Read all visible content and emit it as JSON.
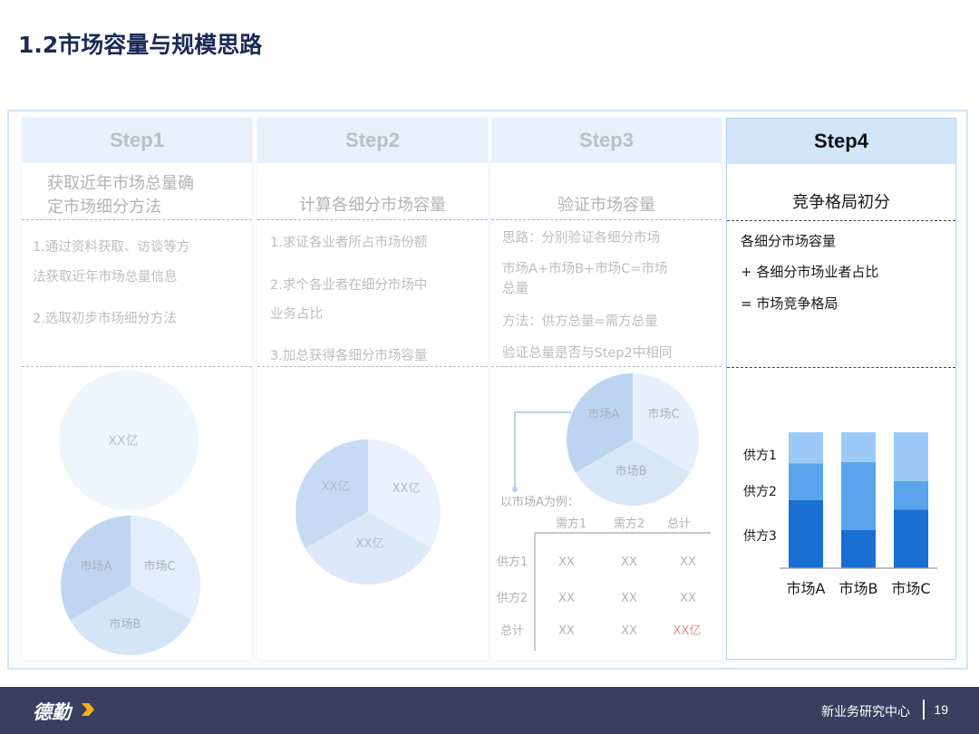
{
  "title": "1.2市场容量与规模思路",
  "steps": [
    {
      "label": "Step1",
      "heading": [
        "获取近年市场总量确",
        "定市场细分方法"
      ],
      "lines": [
        "1.通过资料获取、访谈等方",
        "法获取近年市场总量信息",
        "2.选取初步市场细分方法"
      ],
      "pie_total_label": "XX亿",
      "pie_segments": [
        "市场A",
        "市场C",
        "市场B"
      ]
    },
    {
      "label": "Step2",
      "heading": [
        "计算各细分市场容量"
      ],
      "lines": [
        "1.求证各业者所占市场份额",
        "2.求个各业者在细分市场中",
        "业务占比",
        "3.加总获得各细分市场容量"
      ],
      "pie_segments": [
        "XX亿",
        "XX亿",
        "XX亿"
      ]
    },
    {
      "label": "Step3",
      "heading": [
        "验证市场容量"
      ],
      "lines": [
        "思路：分别验证各细分市场",
        "市场A+市场B+市场C=市场",
        "总量",
        "方法：供方总量=需方总量",
        "验证总量是否与Step2中相同"
      ],
      "pie_segments": [
        "市场A",
        "市场C",
        "市场B"
      ],
      "example_label": "以市场A为例：",
      "table": {
        "columns": [
          "需方1",
          "需方2",
          "总计"
        ],
        "rows": [
          {
            "label": "供方1",
            "cells": [
              "XX",
              "XX",
              "XX"
            ]
          },
          {
            "label": "供方2",
            "cells": [
              "XX",
              "XX",
              "XX"
            ]
          },
          {
            "label": "总计",
            "cells": [
              "XX",
              "XX",
              "XX亿"
            ]
          }
        ]
      }
    },
    {
      "label": "Step4",
      "heading": [
        "竞争格局初分"
      ],
      "lines": [
        "各细分市场容量",
        "+ 各细分市场业者占比",
        "= 市场竞争格局"
      ]
    }
  ],
  "chart_data": {
    "type": "bar",
    "stacked": true,
    "categories": [
      "市场A",
      "市场B",
      "市场C"
    ],
    "series": [
      {
        "name": "供方3",
        "values": [
          50,
          28,
          43
        ],
        "color": "#1a6fd3"
      },
      {
        "name": "供方2",
        "values": [
          27,
          50,
          21
        ],
        "color": "#5aa4ec"
      },
      {
        "name": "供方1",
        "values": [
          23,
          22,
          36
        ],
        "color": "#9ccaf7"
      }
    ],
    "ylim": [
      0,
      100
    ],
    "legend": "left"
  },
  "colors": {
    "active_header": "#d3e5f8",
    "inactive_header": "#e8f1fb",
    "footer": "#3b3e5e",
    "highlight": "#e58a8a"
  },
  "footer": {
    "brand": "德勤",
    "department": "新业务研究中心",
    "page": "19"
  }
}
